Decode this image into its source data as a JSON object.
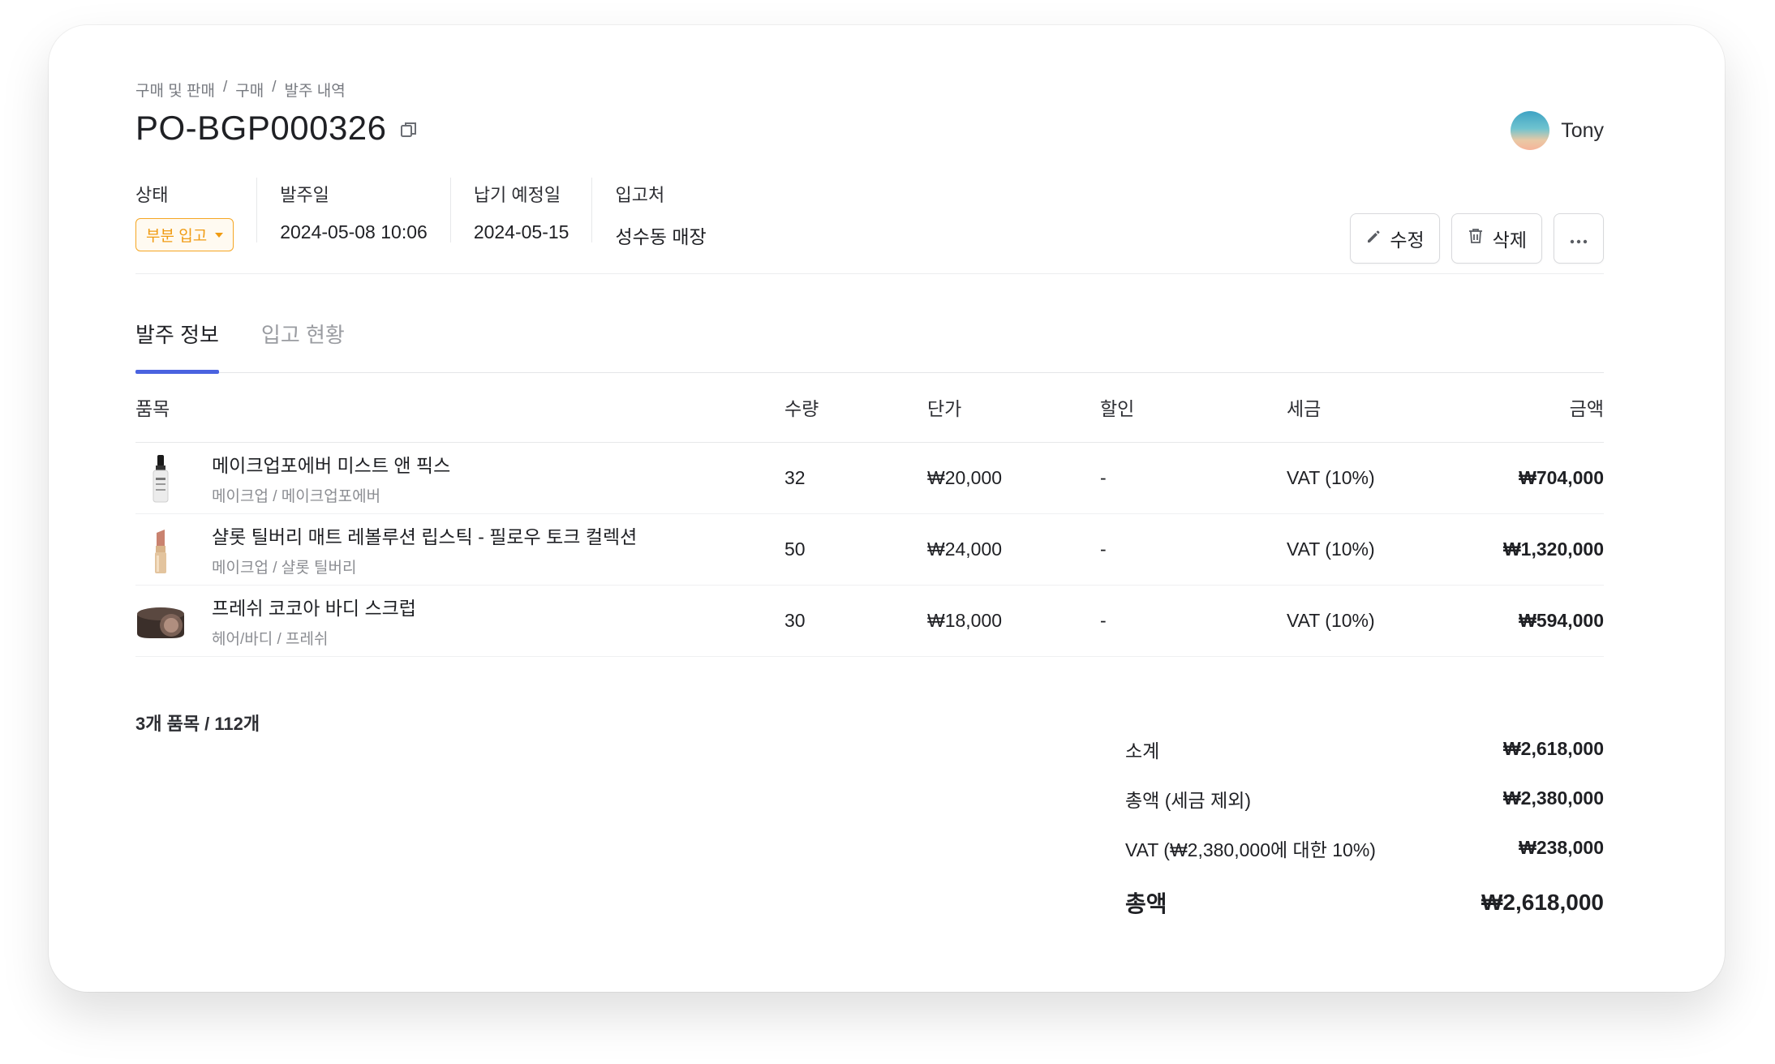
{
  "breadcrumb": [
    "구매 및 판매",
    "/",
    "구매",
    "/",
    "발주 내역"
  ],
  "title": "PO-BGP000326",
  "user": {
    "name": "Tony"
  },
  "meta": {
    "status_label": "상태",
    "status_value": "부분 입고",
    "order_date_label": "발주일",
    "order_date_value": "2024-05-08 10:06",
    "due_date_label": "납기 예정일",
    "due_date_value": "2024-05-15",
    "warehouse_label": "입고처",
    "warehouse_value": "성수동 매장"
  },
  "actions": {
    "edit": "수정",
    "delete": "삭제"
  },
  "tabs": [
    {
      "label": "발주 정보",
      "active": true
    },
    {
      "label": "입고 현황",
      "active": false
    }
  ],
  "table": {
    "headers": {
      "item": "품목",
      "qty": "수량",
      "price": "단가",
      "discount": "할인",
      "tax": "세금",
      "amount": "금액"
    },
    "rows": [
      {
        "name": "메이크업포에버 미스트 앤 픽스",
        "category": "메이크업 / 메이크업포에버",
        "qty": "32",
        "price": "₩20,000",
        "discount": "-",
        "tax": "VAT (10%)",
        "amount": "₩704,000",
        "icon": "mist-spray-bottle-icon"
      },
      {
        "name": "샬롯 틸버리 매트 레볼루션 립스틱 - 필로우 토크 컬렉션",
        "category": "메이크업 / 샬롯 틸버리",
        "qty": "50",
        "price": "₩24,000",
        "discount": "-",
        "tax": "VAT (10%)",
        "amount": "₩1,320,000",
        "icon": "lipstick-icon"
      },
      {
        "name": "프레쉬 코코아 바디 스크럽",
        "category": "헤어/바디 / 프레쉬",
        "qty": "30",
        "price": "₩18,000",
        "discount": "-",
        "tax": "VAT (10%)",
        "amount": "₩594,000",
        "icon": "scrub-jar-icon"
      }
    ]
  },
  "count_text": "3개 품목 / 112개",
  "summary": {
    "subtotal_label": "소계",
    "subtotal": "₩2,618,000",
    "net_label": "총액 (세금 제외)",
    "net": "₩2,380,000",
    "vat_label": "VAT (₩2,380,000에 대한 10%)",
    "vat": "₩238,000",
    "total_label": "총액",
    "total": "₩2,618,000"
  },
  "colors": {
    "accent": "#4a63e0",
    "status": "#f09b12"
  }
}
